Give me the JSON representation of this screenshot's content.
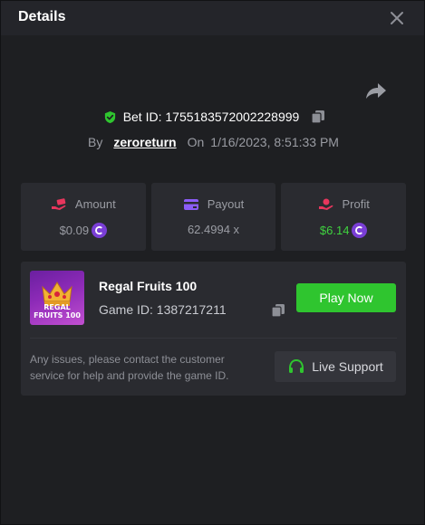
{
  "header": {
    "title": "Details",
    "close_icon": "close-icon"
  },
  "bet": {
    "id_label": "Bet ID: 1755183572002228999",
    "by_label": "By",
    "username": "zeroreturn",
    "on_label": "On",
    "datetime": "1/16/2023, 8:51:33 PM"
  },
  "stats": {
    "amount": {
      "label": "Amount",
      "value": "$0.09",
      "icon": "money-hand-icon"
    },
    "payout": {
      "label": "Payout",
      "value": "62.4994 x",
      "icon": "card-icon"
    },
    "profit": {
      "label": "Profit",
      "value": "$6.14",
      "icon": "profit-hand-icon"
    }
  },
  "game": {
    "name": "Regal Fruits 100",
    "id_label": "Game ID: 1387217211",
    "thumb_text_line1": "REGAL",
    "thumb_text_line2": "FRUITS 100",
    "play_label": "Play Now"
  },
  "support": {
    "text": "Any issues, please contact the customer service for help and provide the game ID.",
    "button_label": "Live Support"
  },
  "colors": {
    "accent_green": "#2fc52f",
    "profit_green": "#3fd23f",
    "icon_pink": "#e8365d",
    "icon_purple": "#8b5cf6",
    "coin_purple": "#7a3ed6"
  }
}
